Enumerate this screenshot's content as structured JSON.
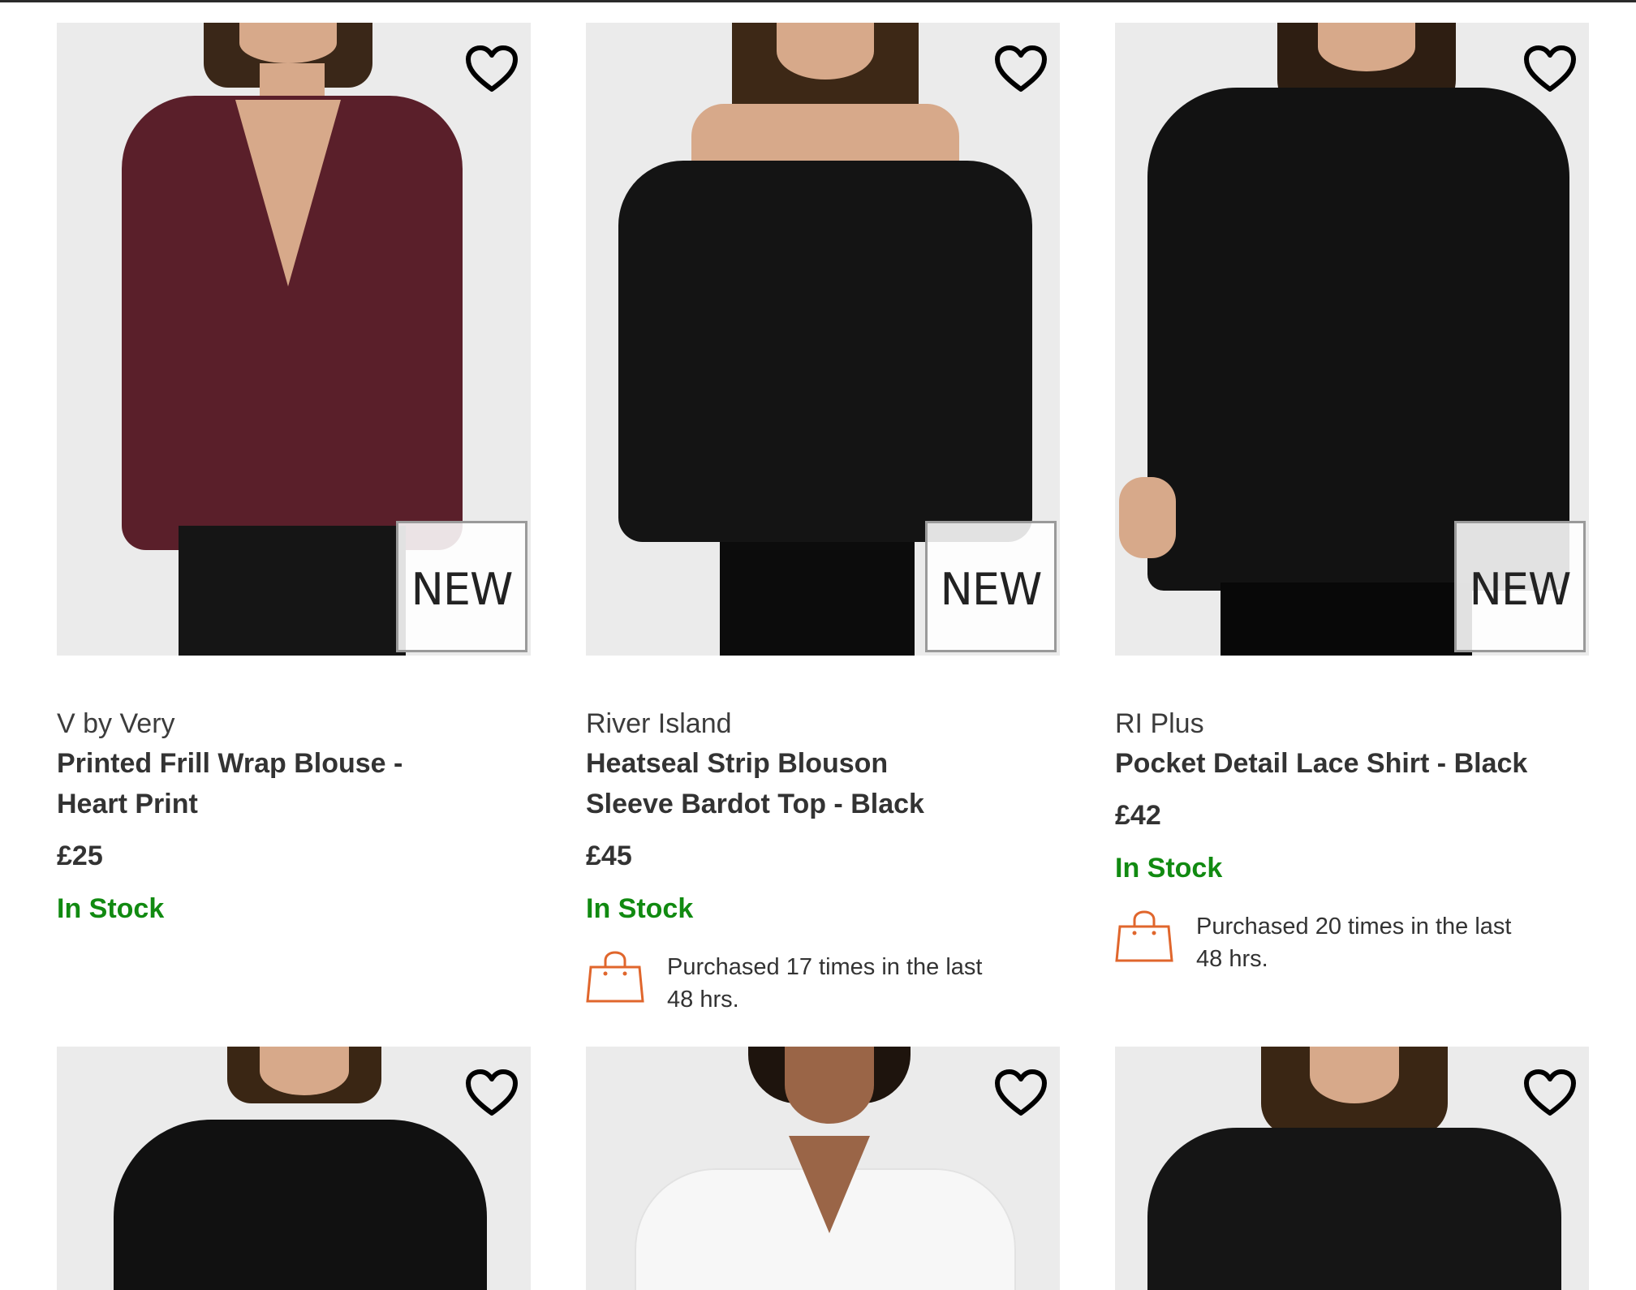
{
  "products": [
    {
      "brand": "V by Very",
      "title": "Printed Frill Wrap Blouse - Heart Print",
      "price": "£25",
      "stock": "In Stock",
      "badge": "NEW",
      "purchased": null,
      "garment_color": "#5a1f2a"
    },
    {
      "brand": "River Island",
      "title": "Heatseal Strip Blouson Sleeve Bardot Top - Black",
      "price": "£45",
      "stock": "In Stock",
      "badge": "NEW",
      "purchased": "Purchased 17 times in the last 48 hrs.",
      "garment_color": "#141414"
    },
    {
      "brand": "RI Plus",
      "title": "Pocket Detail Lace Shirt - Black",
      "price": "£42",
      "stock": "In Stock",
      "badge": "NEW",
      "purchased": "Purchased 20 times in the last 48 hrs.",
      "garment_color": "#121212"
    },
    {
      "garment_color": "#111111"
    },
    {
      "garment_color": "#f7f7f7"
    },
    {
      "garment_color": "#151515"
    }
  ],
  "colors": {
    "in_stock": "#118a11",
    "bag_icon": "#e0662c",
    "text": "#333333",
    "image_bg": "#ebebeb"
  },
  "icons": {
    "wishlist": "heart-outline-icon",
    "purchased": "shopping-bag-icon"
  }
}
